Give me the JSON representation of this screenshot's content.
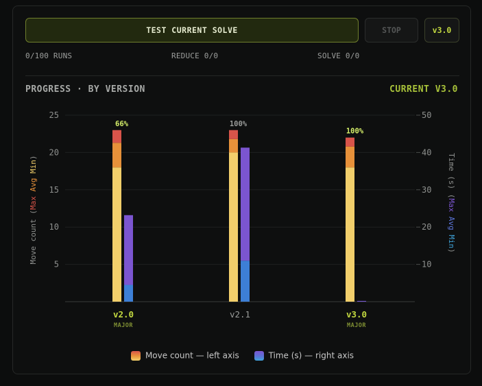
{
  "toolbar": {
    "test_label": "TEST CURRENT SOLVE",
    "stop_label": "STOP",
    "version_label": "v3.0"
  },
  "stats": {
    "runs": "0/100 RUNS",
    "reduce": "REDUCE 0/0",
    "solve": "SOLVE 0/0"
  },
  "section": {
    "title": "PROGRESS · BY VERSION",
    "current": "CURRENT V3.0"
  },
  "legend": {
    "move": "Move count — left axis",
    "time": "Time (s) — right axis"
  },
  "colors": {
    "accent": "#c3d940",
    "move_max": "#d8544a",
    "move_avg": "#e7913a",
    "move_min": "#f2cf6b",
    "time_max": "#7b55d0",
    "time_min": "#3d7fd6"
  },
  "chart_data": {
    "type": "bar",
    "categories": [
      "v2.0",
      "v2.1",
      "v3.0"
    ],
    "category_tags": [
      "MAJOR",
      "",
      "MAJOR"
    ],
    "category_highlight": [
      true,
      false,
      true
    ],
    "left_axis": {
      "label_prefix": "Move count",
      "label_parts": [
        "Max",
        "Avg",
        "Min"
      ],
      "ylim": [
        0,
        25
      ],
      "ticks": [
        5,
        10,
        15,
        20,
        25
      ]
    },
    "right_axis": {
      "label_prefix": "Time (s)",
      "label_parts": [
        "Max",
        "Avg",
        "Min"
      ],
      "ylim": [
        0,
        50
      ],
      "ticks": [
        10,
        20,
        30,
        40,
        50
      ]
    },
    "series": [
      {
        "name": "Move count",
        "axis": "left",
        "min": [
          18,
          20,
          18
        ],
        "avg": [
          21.3,
          21.8,
          20.8
        ],
        "max": [
          23,
          23,
          22
        ]
      },
      {
        "name": "Time (s)",
        "axis": "right",
        "min": [
          4.5,
          11,
          0.1
        ],
        "max": [
          23.2,
          41.3,
          0.2
        ]
      }
    ],
    "success": [
      "66%",
      "100%",
      "100%"
    ],
    "success_highlight": [
      true,
      false,
      true
    ],
    "grid": true,
    "legend_position": "bottom"
  }
}
